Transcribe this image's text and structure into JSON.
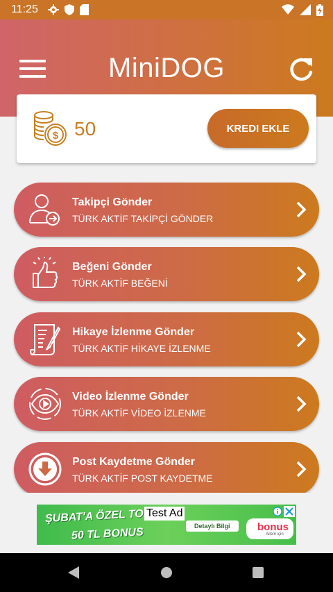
{
  "status": {
    "time": "11:25"
  },
  "header": {
    "title": "MiniDOG"
  },
  "credit": {
    "value": "50",
    "add_label": "KREDI EKLE"
  },
  "menu": [
    {
      "title": "Takipçi Gönder",
      "subtitle": "TÜRK AKTİF TAKİPÇİ GÖNDER",
      "icon": "follower-icon"
    },
    {
      "title": "Beğeni Gönder",
      "subtitle": "TÜRK AKTİF BEĞENİ",
      "icon": "like-icon"
    },
    {
      "title": "Hikaye İzlenme Gönder",
      "subtitle": "TÜRK AKTİF HİKAYE İZLENME",
      "icon": "story-icon"
    },
    {
      "title": "Video İzlenme Gönder",
      "subtitle": "TÜRK AKTİF VİDEO İZLENME",
      "icon": "eye-play-icon"
    },
    {
      "title": "Post Kaydetme Gönder",
      "subtitle": "TÜRK AKTİF POST KAYDETME",
      "icon": "download-icon"
    }
  ],
  "ad": {
    "label": "Test Ad",
    "headline": "ŞUBAT'A ÖZEL TOPL",
    "subline": "50 TL BONUS",
    "cta": "Detaylı Bilgi",
    "brand": "bonus",
    "brand_sub": "Ailem için"
  },
  "colors": {
    "header_start": "#d0646a",
    "header_end": "#cc7a1e",
    "accent": "#c88020",
    "ad_green": "#3fbb4c"
  }
}
